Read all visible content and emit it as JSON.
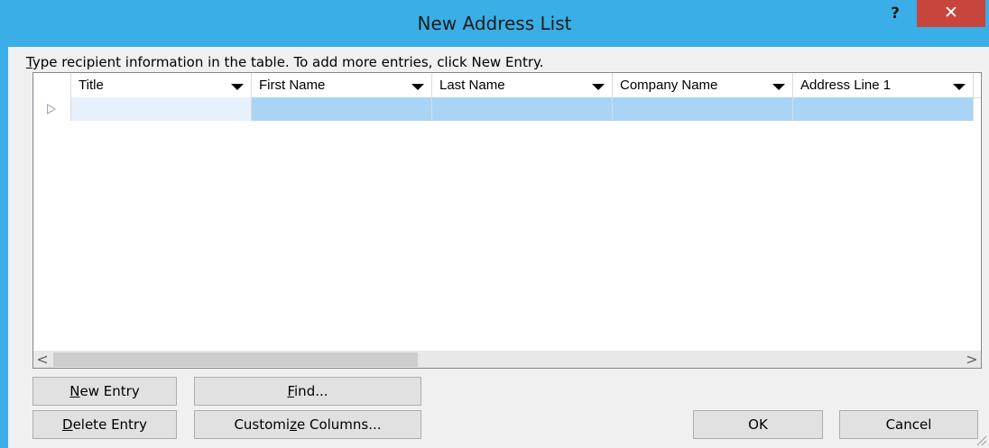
{
  "window": {
    "title": "New Address List",
    "help_label": "?",
    "close_label": "✕"
  },
  "instructions": {
    "prefix": "T",
    "rest": "ype recipient information in the table.  To add more entries, click New Entry."
  },
  "table": {
    "columns": [
      "Title",
      "First Name",
      "Last Name",
      "Company Name",
      "Address Line 1"
    ],
    "rows": [
      [
        "",
        "",
        "",
        "",
        ""
      ]
    ]
  },
  "scrollbar": {
    "left_arrow": "<",
    "right_arrow": ">"
  },
  "buttons": {
    "new_entry": {
      "pre": "",
      "key": "N",
      "post": "ew Entry"
    },
    "find": {
      "pre": "",
      "key": "F",
      "post": "ind..."
    },
    "delete_entry": {
      "pre": "",
      "key": "D",
      "post": "elete Entry"
    },
    "customize_columns": {
      "pre": "Customi",
      "key": "z",
      "post": "e Columns..."
    },
    "ok": "OK",
    "cancel": "Cancel"
  }
}
